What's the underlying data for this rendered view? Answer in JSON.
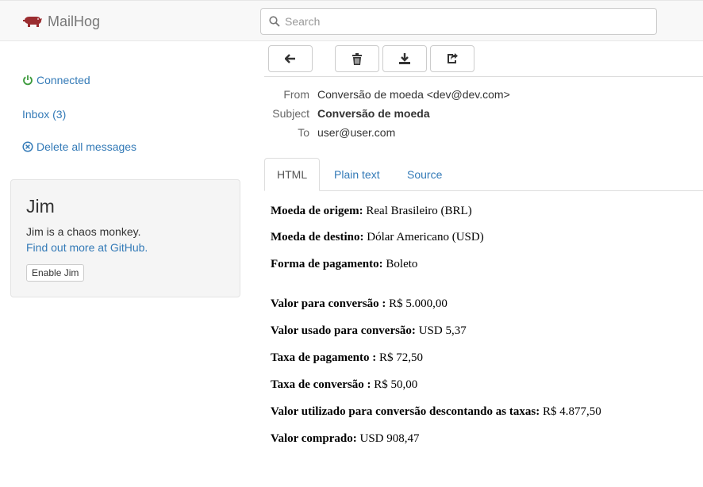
{
  "navbar": {
    "brand": "MailHog",
    "search_placeholder": "Search",
    "brand_color": "#9b2d30"
  },
  "sidebar": {
    "connected": "Connected",
    "inbox": "Inbox (3)",
    "delete_all": "Delete all messages",
    "connected_icon_color": "#3c9a3c",
    "link_color": "#337ab7"
  },
  "jim": {
    "title": "Jim",
    "description": "Jim is a chaos monkey.",
    "github_link": "Find out more at GitHub.",
    "enable_button": "Enable Jim"
  },
  "toolbar": {
    "buttons": [
      "back-arrow-icon",
      "trash-icon",
      "download-icon",
      "share-icon"
    ]
  },
  "message": {
    "from_label": "From",
    "from_value": "Conversão de moeda <dev@dev.com>",
    "subject_label": "Subject",
    "subject_value": "Conversão de moeda",
    "to_label": "To",
    "to_value": "user@user.com"
  },
  "tabs": [
    {
      "label": "HTML",
      "active": true
    },
    {
      "label": "Plain text",
      "active": false
    },
    {
      "label": "Source",
      "active": false
    }
  ],
  "body": {
    "lines": [
      {
        "label": "Moeda de origem:",
        "value": " Real Brasileiro (BRL)"
      },
      {
        "label": "Moeda de destino:",
        "value": " Dólar Americano (USD)"
      },
      {
        "label": "Forma de pagamento:",
        "value": " Boleto"
      },
      {
        "label": "Valor para conversão :",
        "value": " R$ 5.000,00"
      },
      {
        "label": "Valor usado para conversão:",
        "value": " USD 5,37"
      },
      {
        "label": "Taxa de pagamento :",
        "value": " R$ 72,50"
      },
      {
        "label": "Taxa de conversão :",
        "value": " R$ 50,00"
      },
      {
        "label": "Valor utilizado para conversão descontando as taxas:",
        "value": " R$ 4.877,50"
      },
      {
        "label": "Valor comprado:",
        "value": " USD 908,47"
      }
    ]
  }
}
